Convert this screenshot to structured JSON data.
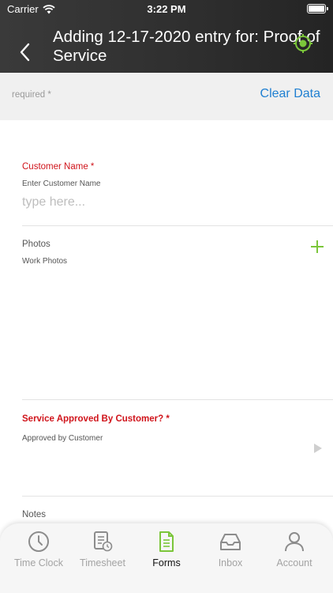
{
  "status_bar": {
    "carrier": "Carrier",
    "time": "3:22 PM"
  },
  "nav": {
    "title": "Adding 12-17-2020 entry for: Proof of Service"
  },
  "subbar": {
    "required": "required *",
    "clear_data": "Clear Data"
  },
  "form": {
    "customer_name": {
      "label": "Customer Name *",
      "sublabel": "Enter Customer Name",
      "placeholder": "type here..."
    },
    "photos": {
      "label": "Photos",
      "sublabel": "Work Photos"
    },
    "service_approved": {
      "label": "Service Approved By Customer? *",
      "sublabel": "Approved by Customer"
    },
    "notes": {
      "label": "Notes"
    }
  },
  "tabs": [
    {
      "label": "Time Clock",
      "icon": "clock-icon",
      "active": false
    },
    {
      "label": "Timesheet",
      "icon": "timesheet-icon",
      "active": false
    },
    {
      "label": "Forms",
      "icon": "forms-icon",
      "active": true
    },
    {
      "label": "Inbox",
      "icon": "inbox-icon",
      "active": false
    },
    {
      "label": "Account",
      "icon": "account-icon",
      "active": false
    }
  ],
  "colors": {
    "accent_green": "#7bc63a",
    "link_blue": "#1f7fd1",
    "required_red": "#d0141b"
  }
}
